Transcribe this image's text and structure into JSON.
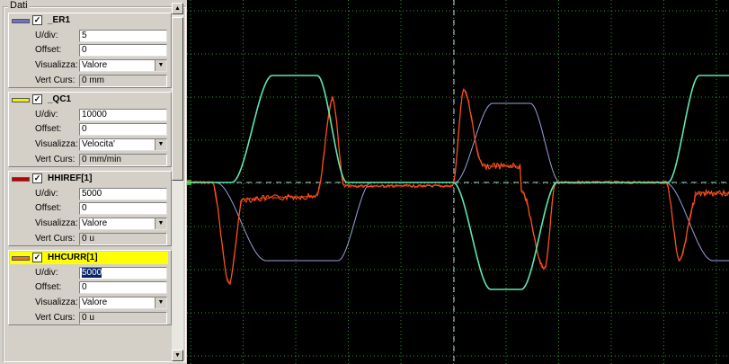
{
  "panel": {
    "title": "Dati",
    "channels": [
      {
        "name": "_ER1",
        "color": "#6f72c4",
        "checked": true,
        "udiv_label": "U/div:",
        "udiv": "5",
        "offset_label": "Offset:",
        "offset": "0",
        "vis_label": "Visualizza:",
        "vis": "Valore",
        "vc_label": "Vert Curs:",
        "vc": "0 mm"
      },
      {
        "name": "_QC1",
        "color": "#f0f000",
        "checked": true,
        "udiv_label": "U/div:",
        "udiv": "10000",
        "offset_label": "Offset:",
        "offset": "0",
        "vis_label": "Visualizza:",
        "vis": "Velocita'",
        "vc_label": "Vert Curs:",
        "vc": "0 mm/min"
      },
      {
        "name": "HHIREF[1]",
        "color": "#c00000",
        "checked": true,
        "udiv_label": "U/div:",
        "udiv": "5000",
        "offset_label": "Offset:",
        "offset": "0",
        "vis_label": "Visualizza:",
        "vis": "Valore",
        "vc_label": "Vert Curs:",
        "vc": "0 u"
      },
      {
        "name": "HHCURR[1]",
        "color": "#f07020",
        "checked": true,
        "udiv_label": "U/div:",
        "udiv": "5000",
        "offset_label": "Offset:",
        "offset": "0",
        "vis_label": "Visualizza:",
        "vis": "Valore",
        "vc_label": "Vert Curs:",
        "vc": "0 u"
      }
    ]
  },
  "scope": {
    "background": "#000000",
    "grid_color": "#2e9a2e",
    "cursor_color": "#a8d8d8",
    "traces": {
      "position": "#9aa0dc",
      "velocity": "#5ee8b0",
      "reference": "#e03010",
      "current": "#ff5a1a"
    }
  }
}
